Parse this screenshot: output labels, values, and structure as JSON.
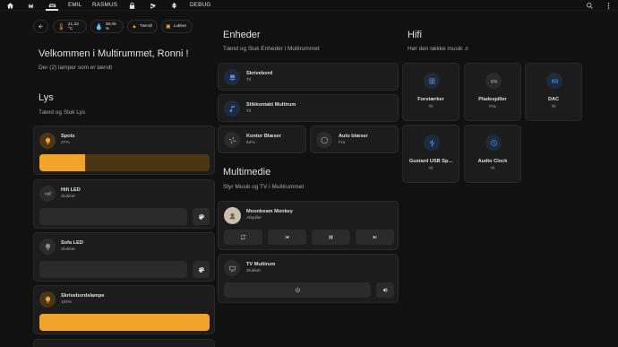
{
  "nav": {
    "items": [
      {
        "label": "EMIL"
      },
      {
        "label": "RASMUS"
      },
      {
        "label": "DEBUG"
      }
    ]
  },
  "chips": {
    "temperature": "21,32 °C",
    "humidity": "39,05 %",
    "lights_on": "Tændt",
    "lock": "Lukket"
  },
  "welcome": {
    "title": "Velkommen i Multirummet, Ronni !",
    "subtitle": "Der (2) lamper som er tændt"
  },
  "lys": {
    "title": "Lys",
    "subtitle": "Tænd og Sluk Lys",
    "items": [
      {
        "name": "Spots",
        "state": "27%",
        "level": 27,
        "color": "#f1a42a"
      },
      {
        "name": "Hifi LED",
        "state": "Slukket",
        "level": 0
      },
      {
        "name": "Sofa LED",
        "state": "Slukket",
        "level": 0
      },
      {
        "name": "Skrivebordslampe",
        "state": "100%",
        "level": 100,
        "color": "#f1a42a"
      }
    ]
  },
  "enheder": {
    "title": "Enheder",
    "subtitle": "Tænd og Sluk Enheder i Multirummet",
    "items": [
      {
        "name": "Skrivebord",
        "state": "Til"
      },
      {
        "name": "Stikkontakt Multirum",
        "state": "Til"
      },
      {
        "name": "Kontor Blæser",
        "state": "54%"
      },
      {
        "name": "Auto blæser",
        "state": "Fra"
      }
    ]
  },
  "multimedie": {
    "title": "Multimedie",
    "subtitle": "Styr Musik og TV i Multirummet",
    "player": {
      "name": "Moonbeam Monkey",
      "state": "Afspiller"
    },
    "tv": {
      "name": "TV Multirum",
      "state": "Slukket"
    }
  },
  "hifi": {
    "title": "Hifi",
    "subtitle": "Hør den lække musik ♬",
    "items": [
      {
        "name": "Forstærker",
        "state": "Til"
      },
      {
        "name": "Pladespiller",
        "state": "Fra"
      },
      {
        "name": "DAC",
        "state": "Til"
      },
      {
        "name": "Gustard USB Sp...",
        "state": "Til"
      },
      {
        "name": "Audio Clock",
        "state": "Til"
      }
    ]
  },
  "colors": {
    "accent_amber": "#f1a42a",
    "accent_blue": "#4d8ddb",
    "background": "#111111",
    "card": "#1c1c1c"
  }
}
